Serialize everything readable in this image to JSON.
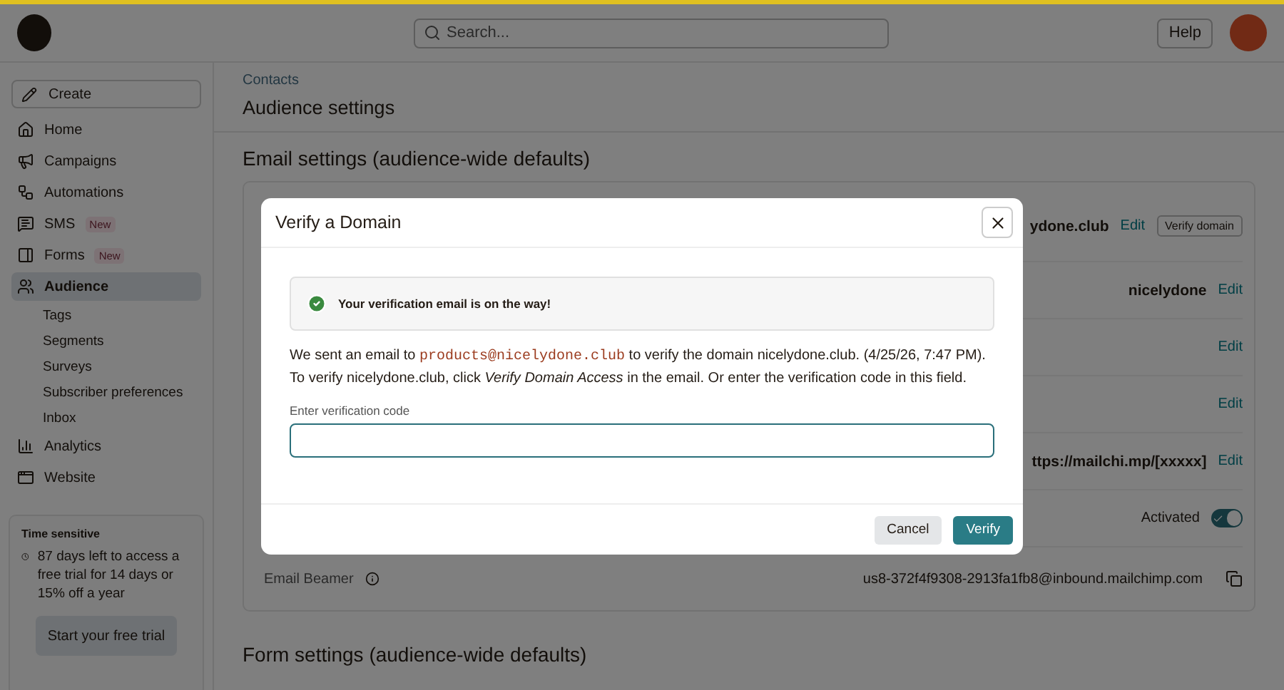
{
  "topbar": {
    "search": {
      "placeholder": "Search..."
    },
    "help": "Help"
  },
  "sidebar": {
    "create": "Create",
    "items": [
      {
        "label": "Home",
        "selected": false
      },
      {
        "label": "Campaigns",
        "selected": false
      },
      {
        "label": "Automations",
        "selected": false
      },
      {
        "label": "SMS",
        "selected": false,
        "badge": "New"
      },
      {
        "label": "Forms",
        "selected": false,
        "badge": "New"
      },
      {
        "label": "Audience",
        "selected": true,
        "children": [
          {
            "label": "Tags"
          },
          {
            "label": "Segments"
          },
          {
            "label": "Surveys"
          },
          {
            "label": "Subscriber preferences"
          },
          {
            "label": "Inbox"
          }
        ]
      },
      {
        "label": "Analytics",
        "selected": false
      },
      {
        "label": "Website",
        "selected": false
      }
    ],
    "trial": {
      "title": "Time sensitive",
      "text": "87 days left to access a free trial for 14 days or 15% off a year",
      "button": "Start your free trial"
    }
  },
  "main": {
    "breadcrumb": "Contacts",
    "title": "Audience settings",
    "email_heading": "Email settings (audience-wide defaults)",
    "form_heading": "Form settings (audience-wide defaults)",
    "rows": [
      {
        "kind": "text",
        "value": "ydone.club",
        "action": "Edit",
        "button": "Verify domain"
      },
      {
        "kind": "text",
        "value": "nicelydone",
        "action": "Edit"
      },
      {
        "kind": "text",
        "action": "Edit"
      },
      {
        "kind": "text",
        "action": "Edit"
      },
      {
        "kind": "text",
        "value": "ttps://mailchi.mp/[xxxxx]",
        "action": "Edit"
      },
      {
        "kind": "toggle",
        "value": "Activated",
        "on": true
      },
      {
        "kind": "copy",
        "label": "Email Beamer",
        "value": "us8-372f4f9308-2913fa1fb8@inbound.mailchimp.com"
      }
    ]
  },
  "dialog": {
    "title": "Verify a Domain",
    "alert": "Your verification email is on the way!",
    "message": [
      {
        "kind": "plain",
        "text": "We sent an email to "
      },
      {
        "kind": "code",
        "text": "products@nicelydone.club"
      },
      {
        "kind": "plain",
        "text": " to verify the domain nicelydone.club. (4/25/26, 7:47 PM). To verify nicelydone.club, click *Verify Domain Access* in the email. Or enter the verification code in this field."
      }
    ],
    "field": {
      "label": "Enter verification code"
    },
    "buttons": [
      {
        "label": "Cancel",
        "kind": "secondary"
      },
      {
        "label": "Verify",
        "kind": "primary"
      }
    ]
  }
}
